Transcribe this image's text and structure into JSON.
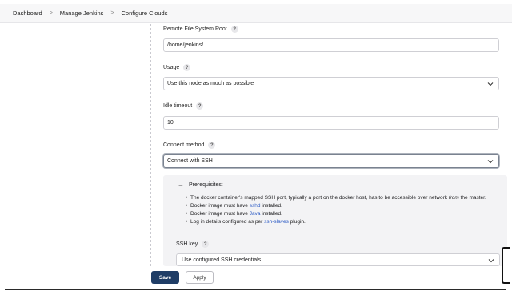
{
  "breadcrumb": {
    "items": [
      "Dashboard",
      "Manage Jenkins",
      "Configure Clouds"
    ],
    "separator": ">"
  },
  "form": {
    "remote_root": {
      "label": "Remote File System Root",
      "value": "/home/jenkins/"
    },
    "usage": {
      "label": "Usage",
      "value": "Use this node as much as possible"
    },
    "idle_timeout": {
      "label": "Idle timeout",
      "value": "10"
    },
    "connect_method": {
      "label": "Connect method",
      "value": "Connect with SSH"
    },
    "help_symbol": "?"
  },
  "prerequisites": {
    "title": "Prerequisites:",
    "arrow": "→",
    "item1": {
      "text_a": "The docker container's mapped SSH port, typically a port on the docker host, has to be accessible over network ",
      "text_em": "from",
      "text_b": " the master."
    },
    "item2": {
      "text_a": "Docker image must have ",
      "link": "sshd",
      "text_b": " installed."
    },
    "item3": {
      "text_a": "Docker image must have ",
      "link": "Java",
      "text_b": " installed."
    },
    "item4": {
      "text_a": "Log in details configured as per ",
      "link": "ssh-slaves",
      "text_b": " plugin."
    }
  },
  "ssh_key": {
    "label": "SSH key",
    "value": "Use configured SSH credentials"
  },
  "buttons": {
    "save": "Save",
    "apply": "Apply"
  },
  "colors": {
    "save_bg": "#1f3d66",
    "link": "#2a59c4",
    "panel_bg": "#f3f3f5"
  },
  "icons": {
    "dropdown": "chevron-down-icon",
    "help": "question-mark-icon",
    "arrow": "right-arrow-icon"
  }
}
